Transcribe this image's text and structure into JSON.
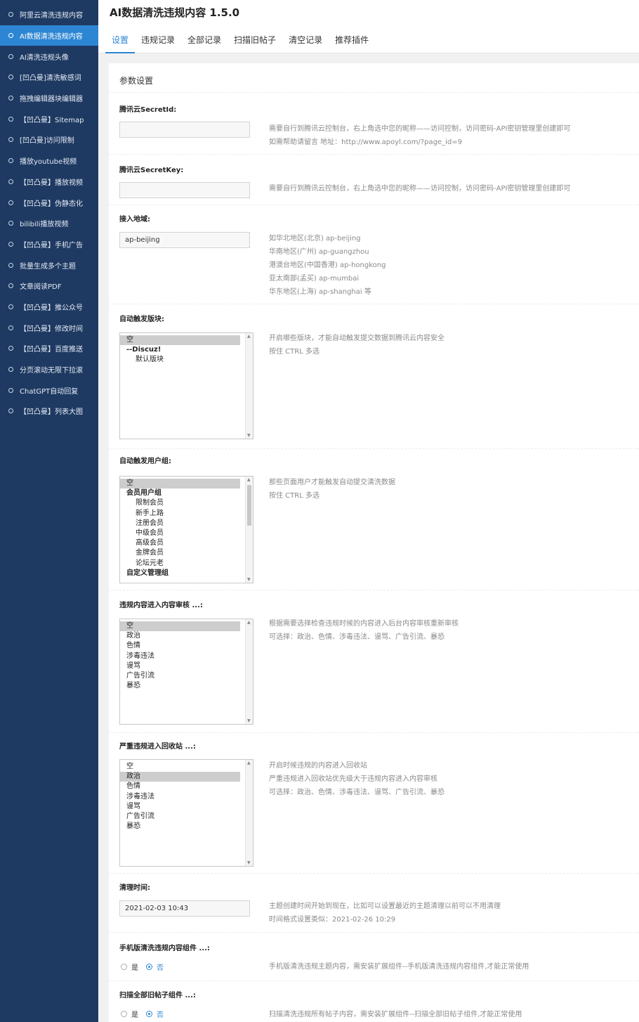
{
  "sidebar": {
    "items": [
      "阿里云清洗违规内容",
      "AI数据清洗违规内容",
      "AI清洗违规头像",
      "[凹凸曼]清洗敏感词",
      "拖拽编辑器块编辑器",
      "【凹凸曼】Sitemap",
      "[凹凸曼]访问限制",
      "播放youtube视频",
      "【凹凸曼】播放视频",
      "【凹凸曼】伪静态化",
      "bilibili播放视频",
      "【凹凸曼】手机广告",
      "批量生成多个主题",
      "文章阅读PDF",
      "【凹凸曼】推公众号",
      "【凹凸曼】修改时间",
      "【凹凸曼】百度推送",
      "分页滚动无限下拉滚",
      "ChatGPT自动回复",
      "【凹凸曼】列表大图"
    ],
    "active_index": 1
  },
  "header": {
    "title": "AI数据清洗违规内容 1.5.0",
    "tabs": [
      "设置",
      "违规记录",
      "全部记录",
      "扫描旧帖子",
      "清空记录",
      "推荐插件"
    ],
    "active_tab": 0
  },
  "panel": {
    "title": "参数设置",
    "secret_id": {
      "label": "腾讯云SecretId:",
      "value": "",
      "desc": [
        "需要自行到腾讯云控制台，右上角选中您的昵称——访问控制，访问密码-API密钥管理里创建即可",
        "如需帮助请留言 地址：http://www.apoyl.com/?page_id=9"
      ]
    },
    "secret_key": {
      "label": "腾讯云SecretKey:",
      "value": "",
      "desc": [
        "需要自行到腾讯云控制台，右上角选中您的昵称——访问控制，访问密码-API密钥管理里创建即可"
      ]
    },
    "endpoint": {
      "label": "接入地域:",
      "value": "ap-beijing",
      "desc": [
        "如华北地区(北京) ap-beijing",
        "华南地区(广州) ap-guangzhou",
        "港澳台地区(中国香港) ap-hongkong",
        "亚太南部(孟买) ap-mumbai",
        "华东地区(上海) ap-shanghai 等"
      ]
    },
    "forums": {
      "label": "自动触发版块:",
      "options": [
        "空",
        "--Discuz!",
        "默认版块"
      ],
      "selected": [
        0
      ],
      "desc": [
        "开启哪些版块，才能自动触发提交数据到腾讯云内容安全",
        "按住 CTRL 多选"
      ]
    },
    "usergroups": {
      "label": "自动触发用户组:",
      "options": [
        "空",
        "会员用户组",
        "限制会员",
        "新手上路",
        "注册会员",
        "中级会员",
        "高级会员",
        "金牌会员",
        "论坛元老",
        "自定义管理组"
      ],
      "selected": [
        0
      ],
      "desc": [
        "那些页面用户才能触发自动提交清洗数据",
        "按住 CTRL 多选"
      ]
    },
    "review": {
      "label": "违规内容进入内容审核 ...:",
      "options": [
        "空",
        "政治",
        "色情",
        "涉毒违法",
        "谩骂",
        "广告引流",
        "暴恐"
      ],
      "selected": [
        0
      ],
      "desc": [
        "根据需要选择检查违规时候的内容进入后台内容审核重新审核",
        "可选择：政治、色情、涉毒违法、谩骂、广告引流、暴恐"
      ]
    },
    "recycle": {
      "label": "严重违规进入回收站 ...:",
      "options": [
        "空",
        "政治",
        "色情",
        "涉毒违法",
        "谩骂",
        "广告引流",
        "暴恐"
      ],
      "selected": [
        1
      ],
      "desc": [
        "开启时候违规的内容进入回收站",
        "严重违规进入回收站优先级大于违规内容进入内容审核",
        "可选择：政治、色情、涉毒违法、谩骂、广告引流、暴恐"
      ]
    },
    "cleantime": {
      "label": "清理时间:",
      "value": "2021-02-03 10:43",
      "desc": [
        "主题创建时间开始到现在，比如可以设置最近的主题清理以前可以不用清理",
        "时间格式设置类似：2021-02-26 10:29"
      ]
    },
    "mobile_component": {
      "label": "手机版清洗违规内容组件 ...:",
      "yes": "是",
      "no": "否",
      "value": "否",
      "desc": [
        "手机版清洗违规主题内容，需安装扩展组件--手机版清洗违规内容组件,才能正常使用"
      ]
    },
    "scan_component": {
      "label": "扫描全部旧帖子组件 ...:",
      "yes": "是",
      "no": "否",
      "value": "否",
      "desc": [
        "扫描清洗违规所有帖子内容，需安装扩展组件--扫描全部旧帖子组件,才能正常使用"
      ]
    }
  }
}
